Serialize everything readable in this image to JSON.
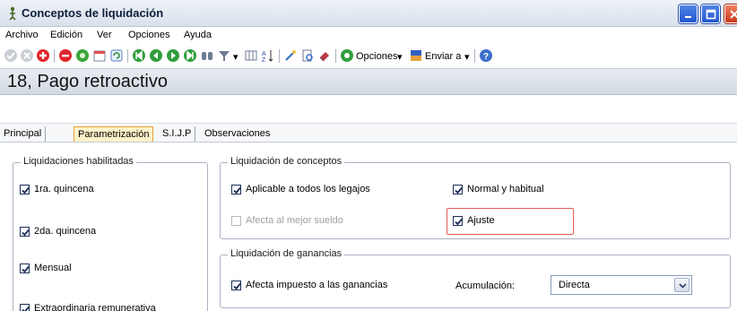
{
  "window": {
    "title": "Conceptos de liquidación"
  },
  "menu": {
    "items": [
      {
        "label": "Archivo"
      },
      {
        "label": "Edición"
      },
      {
        "label": "Ver"
      },
      {
        "label": "Opciones"
      },
      {
        "label": "Ayuda"
      }
    ]
  },
  "toolbar": {
    "opciones_label": "Opciones",
    "enviar_label": "Enviar a"
  },
  "header": {
    "title": "18, Pago retroactivo"
  },
  "tabs": [
    {
      "label": "Principal"
    },
    {
      "label": "Parametrización"
    },
    {
      "label": "S.I.J.P"
    },
    {
      "label": "Observaciones"
    }
  ],
  "active_tab": "Parametrización",
  "liquidaciones_habilitadas": {
    "legend": "Liquidaciones habilitadas",
    "items": [
      {
        "label": "1ra. quincena",
        "checked": true
      },
      {
        "label": "2da. quincena",
        "checked": true
      },
      {
        "label": "Mensual",
        "checked": true
      },
      {
        "label": "Extraordinaria remunerativa",
        "checked": true
      }
    ]
  },
  "liquidacion_conceptos": {
    "legend": "Liquidación de conceptos",
    "aplicable": {
      "label": "Aplicable a todos los legajos",
      "checked": true
    },
    "normal": {
      "label": "Normal y habitual",
      "checked": true
    },
    "afecta_mejor": {
      "label": "Afecta al mejor sueldo",
      "checked": false
    },
    "ajuste": {
      "label": "Ajuste",
      "checked": true
    }
  },
  "liquidacion_ganancias": {
    "legend": "Liquidación de ganancias",
    "afecta_impuesto": {
      "label": "Afecta impuesto a las ganancias",
      "checked": true
    },
    "acumulacion_label": "Acumulación:",
    "acumulacion_value": "Directa"
  },
  "colors": {
    "highlight": "#e05b5b",
    "active_tab_bg": "#fff2c8"
  }
}
